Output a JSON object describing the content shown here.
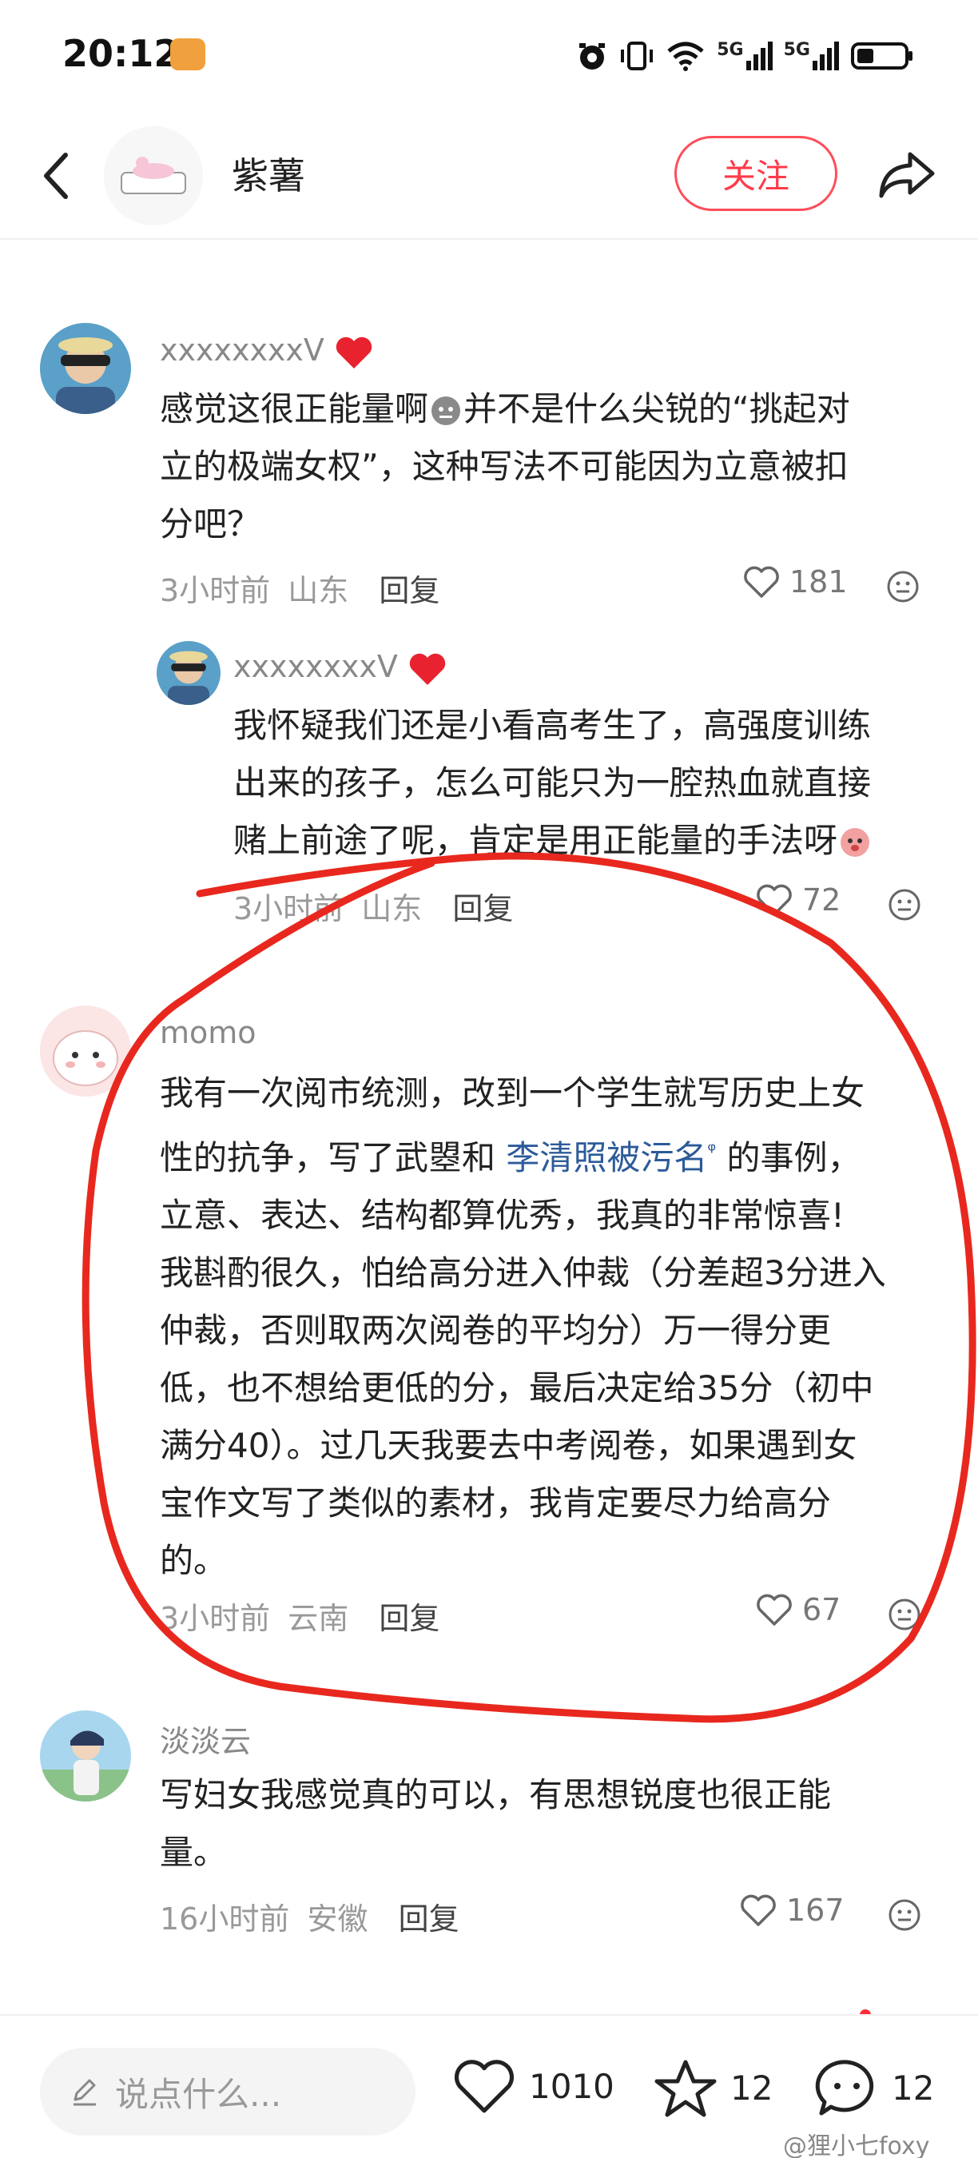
{
  "status_bar": {
    "time": "20:12",
    "icons": [
      "alarm-icon",
      "vibrate-icon",
      "wifi-icon",
      "signal-5g-icon",
      "signal-5g-icon",
      "battery-icon"
    ],
    "network_label_1": "5G",
    "network_label_2": "5G"
  },
  "header": {
    "name": "紫薯",
    "follow_label": "关注"
  },
  "comments": [
    {
      "user": "xxxxxxxxV",
      "text": "感觉这很正能量啊😶并不是什么尖锐的“挑起对立的极端女权”，这种写法不可能因为立意被扣分吧？",
      "line1": "感觉这很正能量啊",
      "line1b": "并不是什么尖锐的“挑起对",
      "line2": "立的极端女权”，这种写法不可能因为立意被扣",
      "line3": "分吧？",
      "time": "3小时前",
      "location": "山东",
      "reply": "回复",
      "likes": "181"
    },
    {
      "user": "xxxxxxxxV",
      "line1": "我怀疑我们还是小看高考生了，高强度训练",
      "line2": "出来的孩子，怎么可能只为一腔热血就直接",
      "line3": "赌上前途了呢，肯定是用正能量的手法呀",
      "time": "3小时前",
      "location": "山东",
      "reply": "回复",
      "likes": "72"
    },
    {
      "user": "momo",
      "line1": "我有一次阅市统测，改到一个学生就写历史上女",
      "line2a": "性的抗争，写了武曌和 ",
      "line2link": "李清照被污名",
      "line2b": " 的事例，",
      "line3": "立意、表达、结构都算优秀，我真的非常惊喜!",
      "line4": "我斟酌很久，怕给高分进入仲裁（分差超3分进入",
      "line5": "仲裁，否则取两次阅卷的平均分）万一得分更",
      "line6": "低，也不想给更低的分，最后决定给35分（初中",
      "line7": "满分40）。过几天我要去中考阅卷，如果遇到女",
      "line8": "宝作文写了类似的素材，我肯定要尽力给高分",
      "line9": "的。",
      "time": "3小时前",
      "location": "云南",
      "reply": "回复",
      "likes": "67"
    },
    {
      "user": "淡淡云",
      "line1": "写妇女我感觉真的可以，有思想锐度也很正能",
      "line2": "量。",
      "time": "16小时前",
      "location": "安徽",
      "reply": "回复",
      "likes": "167"
    }
  ],
  "bottom_bar": {
    "input_placeholder": "说点什么...",
    "likes": "1010",
    "stars": "12",
    "comments": "12"
  },
  "watermark": "@狸小七foxy",
  "colors": {
    "accent_red": "#ff3b4a",
    "annotation_red": "#e8281e",
    "link_blue": "#2d5b9a"
  }
}
